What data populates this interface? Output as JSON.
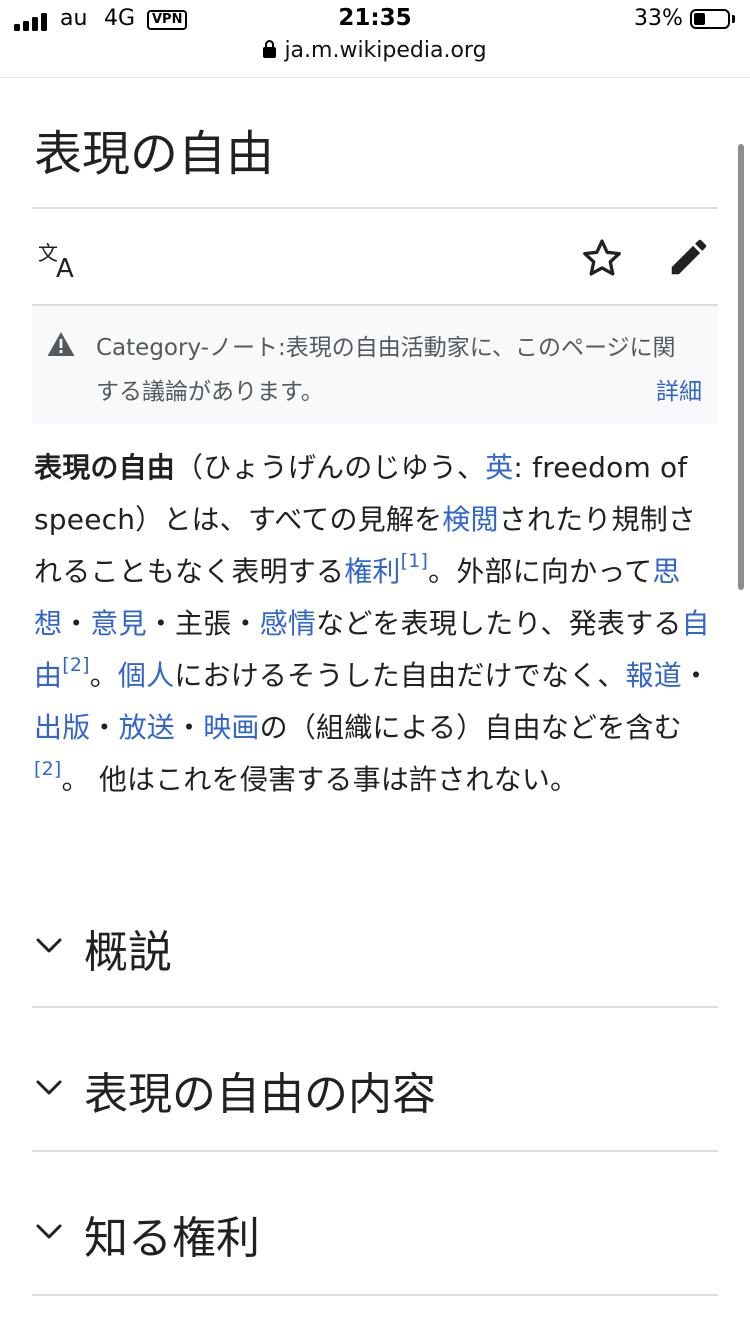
{
  "status_bar": {
    "carrier": "au",
    "network": "4G",
    "vpn": "VPN",
    "time": "21:35",
    "battery": "33%",
    "battery_level": 0.33,
    "signal_bars": 4
  },
  "browser": {
    "url": "ja.m.wikipedia.org"
  },
  "article": {
    "title": "表現の自由",
    "toolbar": {
      "language_icon": "translate-icon",
      "watch_icon": "star-icon",
      "edit_icon": "pencil-icon"
    },
    "notice": {
      "text": "Category-ノート:表現の自由活動家に、このページに関する議論があります。",
      "more": "詳細"
    },
    "lead": {
      "term": "表現の自由",
      "t1": "（ひょうげんのじゆう、",
      "l_en": "英",
      "t2": ": freedom of speech）とは、すべての見解を",
      "l_censor": "検閲",
      "t3": "されたり規制されることもなく表明する",
      "l_right": "権利",
      "ref1": "[1]",
      "t4": "。外部に向かって",
      "l_thought": "思想",
      "sep1": "・",
      "l_opinion": "意見",
      "t5": "・主張・",
      "l_emotion": "感情",
      "t6": "などを表現したり、発表する",
      "l_freedom": "自由",
      "ref2": "[2]",
      "t7": "。",
      "l_individual": "個人",
      "t8": "におけるそうした自由だけでなく、",
      "l_news": "報道",
      "sep2": "・",
      "l_publish": "出版",
      "sep3": "・",
      "l_broadcast": "放送",
      "sep4": "・",
      "l_film": "映画",
      "t9": "の（組織による）自由などを含む",
      "ref3": "[2]",
      "t10": "。 他はこれを侵害する事は許されない。"
    },
    "sections": [
      {
        "title": "概説"
      },
      {
        "title": "表現の自由の内容"
      },
      {
        "title": "知る権利"
      }
    ]
  },
  "colors": {
    "link": "#3366cc",
    "text": "#202122",
    "notice_bg": "#f8f9fa",
    "divider": "#dddddd"
  }
}
